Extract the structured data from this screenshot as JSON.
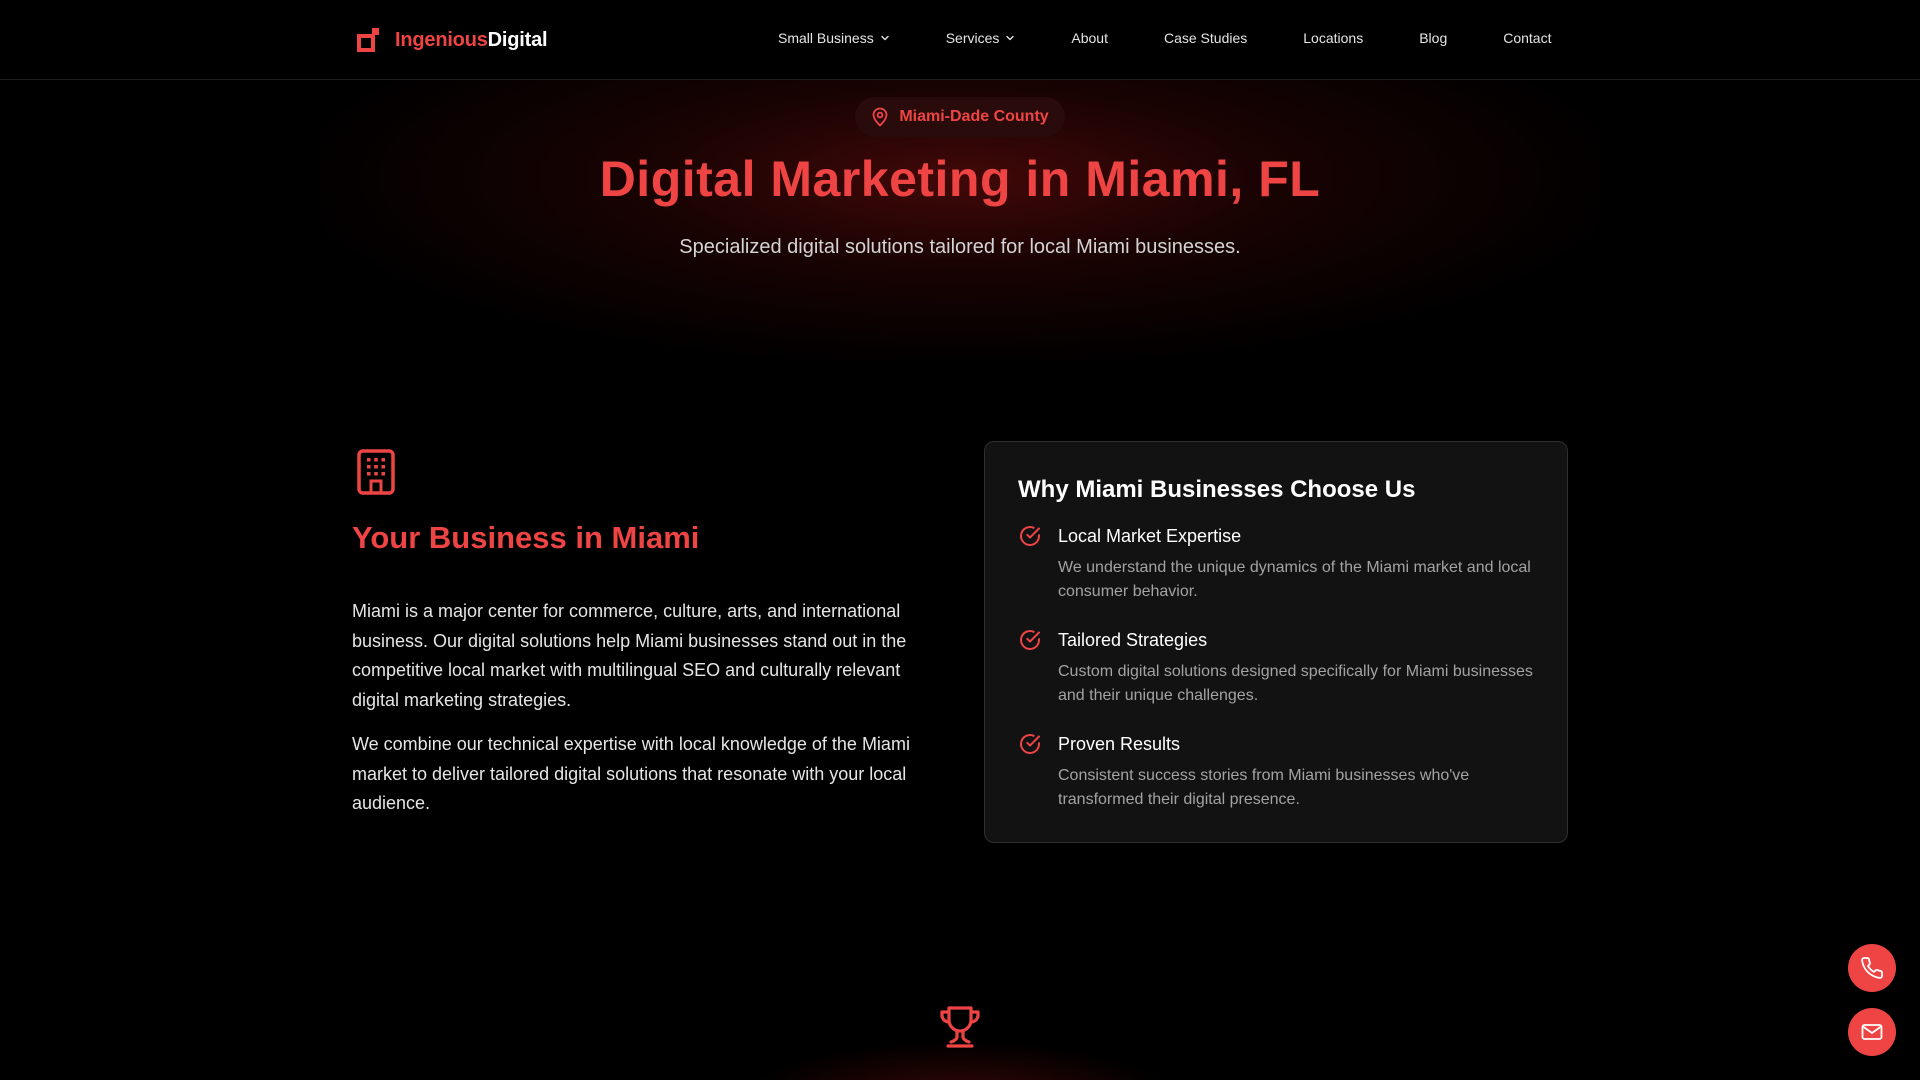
{
  "brand": {
    "name_part1": "Ingenious",
    "name_part2": "Digital",
    "accent": "#ef4444"
  },
  "nav": {
    "items": [
      {
        "label": "Small Business",
        "dropdown": true
      },
      {
        "label": "Services",
        "dropdown": true
      },
      {
        "label": "About",
        "dropdown": false
      },
      {
        "label": "Case Studies",
        "dropdown": false
      },
      {
        "label": "Locations",
        "dropdown": false
      },
      {
        "label": "Blog",
        "dropdown": false
      },
      {
        "label": "Contact",
        "dropdown": false
      }
    ]
  },
  "hero": {
    "badge": "Miami-Dade County",
    "badge_icon": "map-pin-icon",
    "title": "Digital Marketing in Miami, FL",
    "subtitle": "Specialized digital solutions tailored for local Miami businesses."
  },
  "business": {
    "icon": "building-icon",
    "title": "Your Business in Miami",
    "paragraph1": "Miami is a major center for commerce, culture, arts, and international business. Our digital solutions help Miami businesses stand out in the competitive local market with multilingual SEO and culturally relevant digital marketing strategies.",
    "paragraph2": "We combine our technical expertise with local knowledge of the Miami market to deliver tailored digital solutions that resonate with your local audience."
  },
  "why": {
    "title": "Why Miami Businesses Choose Us",
    "reasons": [
      {
        "title": "Local Market Expertise",
        "description": "We understand the unique dynamics of the Miami market and local consumer behavior."
      },
      {
        "title": "Tailored Strategies",
        "description": "Custom digital solutions designed specifically for Miami businesses and their unique challenges."
      },
      {
        "title": "Proven Results",
        "description": "Consistent success stories from Miami businesses who've transformed their digital presence."
      }
    ]
  },
  "icons": {
    "trophy": "trophy-icon",
    "phone": "phone-icon",
    "mail": "mail-icon"
  }
}
